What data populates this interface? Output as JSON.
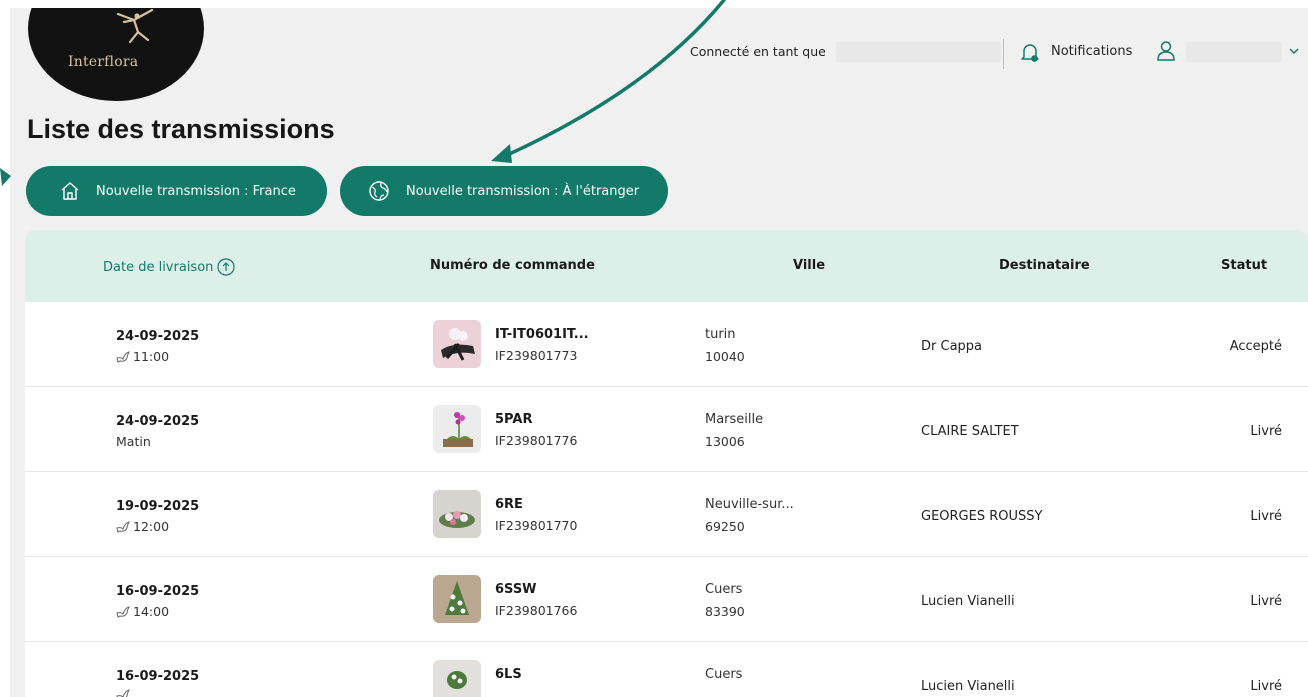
{
  "colors": {
    "accent": "#137a6a",
    "header_row": "#dcefe9",
    "page_bg": "#f0f0f0",
    "logo_bg": "#121212",
    "logo_text": "#d6c29b"
  },
  "logo": {
    "text": "Interflora",
    "icon": "mercury-logo-icon"
  },
  "header": {
    "connected_label": "Connecté en tant que",
    "notifications_label": "Notifications",
    "icons": [
      "bell-icon",
      "user-icon",
      "chevron-down-icon"
    ]
  },
  "page": {
    "title": "Liste des transmissions"
  },
  "buttons": {
    "new_france": {
      "label": "Nouvelle transmission : France",
      "icon": "house-icon"
    },
    "new_abroad": {
      "label": "Nouvelle transmission : À l'étranger",
      "icon": "globe-icon"
    }
  },
  "table": {
    "headers": {
      "date": "Date de livraison",
      "order": "Numéro de commande",
      "city": "Ville",
      "recipient": "Destinataire",
      "status": "Statut"
    },
    "rows": [
      {
        "date": "24-09-2025",
        "time": "11:00",
        "time_icon": "dove-icon",
        "code": "IT-IT0601IT...",
        "ref": "IF239801773",
        "city": "turin",
        "zip": "10040",
        "recipient": "Dr Cappa",
        "status": "Accepté"
      },
      {
        "date": "24-09-2025",
        "time": "Matin",
        "time_icon": "",
        "code": "5PAR",
        "ref": "IF239801776",
        "city": "Marseille",
        "zip": "13006",
        "recipient": "CLAIRE SALTET",
        "status": "Livré"
      },
      {
        "date": "19-09-2025",
        "time": "12:00",
        "time_icon": "dove-icon",
        "code": "6RE",
        "ref": "IF239801770",
        "city": "Neuville-sur...",
        "zip": "69250",
        "recipient": "GEORGES ROUSSY",
        "status": "Livré"
      },
      {
        "date": "16-09-2025",
        "time": "14:00",
        "time_icon": "dove-icon",
        "code": "6SSW",
        "ref": "IF239801766",
        "city": "Cuers",
        "zip": "83390",
        "recipient": "Lucien Vianelli",
        "status": "Livré"
      },
      {
        "date": "16-09-2025",
        "time": "",
        "time_icon": "dove-icon",
        "code": "6LS",
        "ref": "",
        "city": "Cuers",
        "zip": "",
        "recipient": "Lucien Vianelli",
        "status": "Livré"
      }
    ]
  }
}
